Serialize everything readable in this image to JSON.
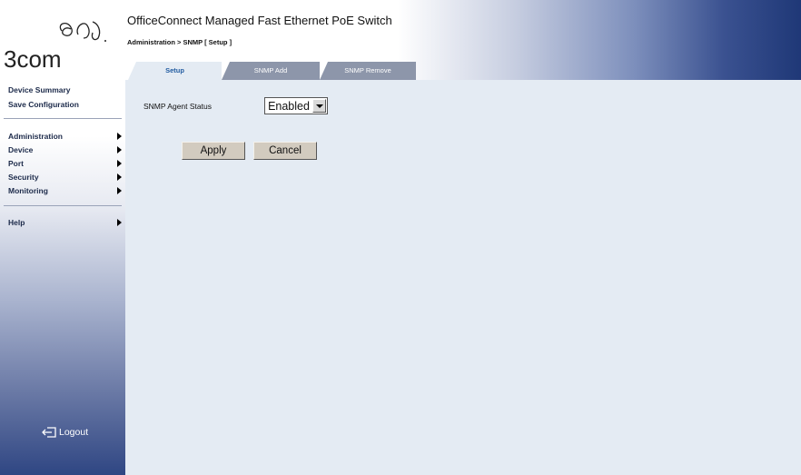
{
  "brand": {
    "logo_text": "3com"
  },
  "header": {
    "title": "OfficeConnect Managed Fast Ethernet PoE Switch",
    "breadcrumb": "Administration > SNMP [ Setup ]"
  },
  "sidebar": {
    "links": [
      "Device Summary",
      "Save Configuration"
    ],
    "menu": [
      "Administration",
      "Device",
      "Port",
      "Security",
      "Monitoring"
    ],
    "help": "Help",
    "logout": "Logout"
  },
  "tabs": [
    "Setup",
    "SNMP Add",
    "SNMP Remove"
  ],
  "form": {
    "agent_status_label": "SNMP Agent Status",
    "agent_status_value": "Enabled",
    "apply_label": "Apply",
    "cancel_label": "Cancel"
  },
  "colors": {
    "content_bg": "#e4ebf3",
    "tab_active_text": "#215ba0",
    "tab_inactive_bg": "#8d96aa",
    "brand_dark": "#1f3877"
  }
}
